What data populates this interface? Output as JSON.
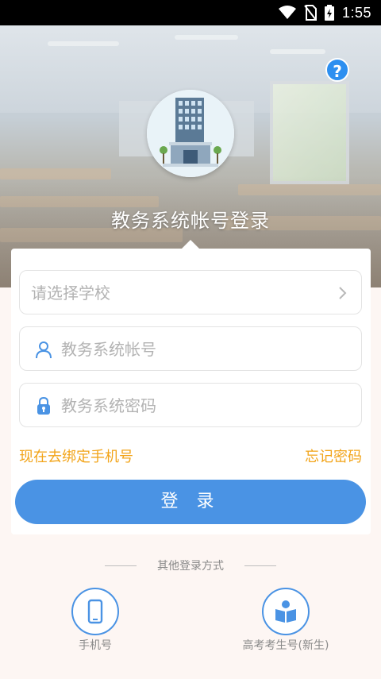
{
  "status_bar": {
    "time": "1:55",
    "icons": [
      "wifi-icon",
      "no-sim-icon",
      "battery-charging-icon"
    ]
  },
  "header": {
    "help_label": "?",
    "title": "教务系统帐号登录"
  },
  "form": {
    "school_select": {
      "placeholder": "请选择学校"
    },
    "account_field": {
      "placeholder": "教务系统帐号",
      "icon": "user-icon"
    },
    "password_field": {
      "placeholder": "教务系统密码",
      "icon": "lock-icon"
    },
    "bind_phone_link": "现在去绑定手机号",
    "forgot_password_link": "忘记密码",
    "login_button": "登 录"
  },
  "other_login": {
    "label": "其他登录方式",
    "methods": [
      {
        "label": "手机号",
        "icon": "phone-icon"
      },
      {
        "label": "高考考生号(新生)",
        "icon": "reader-icon"
      }
    ]
  },
  "colors": {
    "accent": "#4a93e4",
    "link": "#f2a419",
    "help": "#2d8ff0"
  }
}
